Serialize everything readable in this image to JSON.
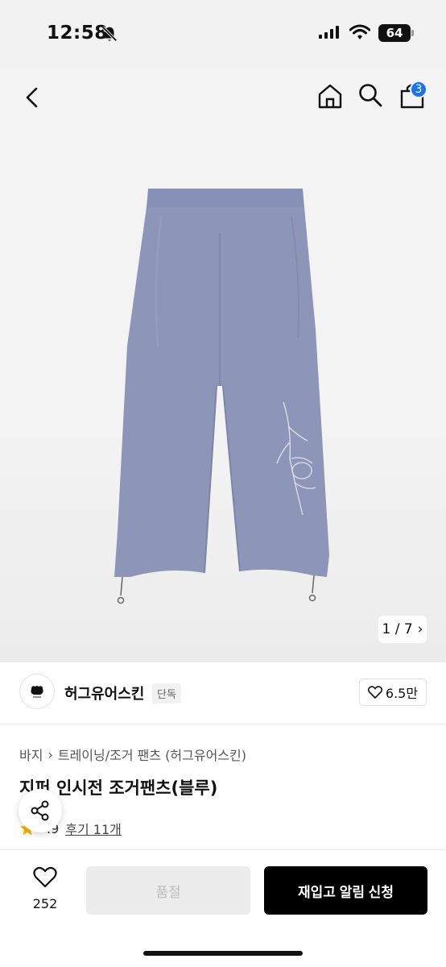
{
  "status_bar": {
    "time": "12:58",
    "battery": "64"
  },
  "nav": {
    "cart_count": "3"
  },
  "gallery": {
    "counter": "1 / 7",
    "counter_arrow": "›"
  },
  "brand": {
    "name": "허그유어스킨",
    "tag": "단독",
    "likes": "6.5만"
  },
  "breadcrumb": {
    "category": "바지",
    "separator": "›",
    "subcategory": "트레이닝/조거 팬츠 (허그유어스킨)"
  },
  "product": {
    "title": "지퍼 인시전 조거팬츠(블루)",
    "rating_partial": ".9",
    "review_label": "후기 11개"
  },
  "bottom": {
    "wish_count": "252",
    "soldout_label": "품절",
    "restock_label": "재입고 알림 신청"
  },
  "colors": {
    "pants": "#8d96b8",
    "badge": "#1a73e8",
    "primary_button": "#000000"
  }
}
